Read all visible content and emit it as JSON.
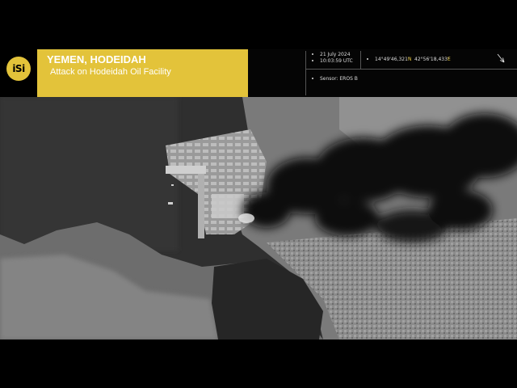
{
  "header": {
    "logo_text": "iSi",
    "title": "YEMEN, HODEIDAH",
    "subtitle": "Attack on Hodeidah Oil Facility",
    "date": "21 July 2024",
    "time": "10:03:59 UTC",
    "sensor": "Sensor: EROS B",
    "lat": "14°49'46,321\"",
    "lat_dir": "N",
    "lon": "42°56'18,433\"",
    "lon_dir": "E",
    "north_icon": "north-arrow-icon"
  },
  "colors": {
    "accent": "#e3c33a",
    "background": "#000000"
  }
}
